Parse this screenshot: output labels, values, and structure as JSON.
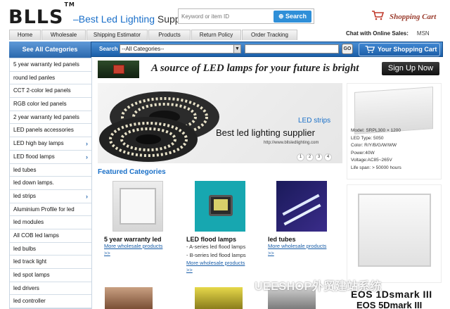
{
  "header": {
    "logo": "BLLS",
    "trademark": "TM",
    "tagline_prefix": "–Best ",
    "tagline_highlight": "Led Lighting",
    "tagline_suffix": " Supplier",
    "search_placeholder": "Keyword or item ID",
    "search_button": "Search",
    "cart_link": "Shopping Cart"
  },
  "nav": {
    "tabs": [
      {
        "label": "Home"
      },
      {
        "label": "Wholesale"
      },
      {
        "label": "Shipping Estimator"
      },
      {
        "label": "Products"
      },
      {
        "label": "Return Policy"
      },
      {
        "label": "Order Tracking"
      }
    ],
    "chat_label": "Chat with Online Sales:",
    "msn": "MSN"
  },
  "searchbar": {
    "see_all": "See All Categories",
    "label": "Search",
    "category_selected": "--All Categories--",
    "go": "GO",
    "cart_button": "Your Shopping Cart"
  },
  "sidebar": {
    "items": [
      {
        "label": "5 year warranty led panels",
        "chev": ""
      },
      {
        "label": "round led panles",
        "chev": ""
      },
      {
        "label": "CCT 2-color led panels",
        "chev": ""
      },
      {
        "label": "RGB color led panels",
        "chev": ""
      },
      {
        "label": "2 year warranty led panels",
        "chev": ""
      },
      {
        "label": "LED panels accessories",
        "chev": ""
      },
      {
        "label": "LED high bay lamps",
        "chev": "›"
      },
      {
        "label": "LED flood lamps",
        "chev": "›"
      },
      {
        "label": "led tubes",
        "chev": ""
      },
      {
        "label": "led down lamps.",
        "chev": ""
      },
      {
        "label": "led strips",
        "chev": "›"
      },
      {
        "label": "Aluminium Profile for led",
        "chev": ""
      },
      {
        "label": "led modules",
        "chev": ""
      },
      {
        "label": "All COB led lamps",
        "chev": ""
      },
      {
        "label": "led bulbs",
        "chev": ""
      },
      {
        "label": "led track light",
        "chev": ""
      },
      {
        "label": "led spot lamps",
        "chev": ""
      },
      {
        "label": "led drivers",
        "chev": ""
      },
      {
        "label": "led controller",
        "chev": ""
      }
    ]
  },
  "banner": {
    "slogan": "A source of LED lamps for your future is bright",
    "signup": "Sign Up Now"
  },
  "hero": {
    "category": "LED strips",
    "headline": "Best led lighting supplier",
    "url": "http://www.bllsledlighting.com",
    "pages": [
      "1",
      "2",
      "3",
      "4"
    ]
  },
  "side_product": {
    "specs": [
      "Model: SRPL300 × 1200",
      "LED Type: 5050",
      "Color: R/Y/B/G/W/WW",
      "Power:40W",
      "Voltage:AC85~265V",
      "Life span: > 50000 hours"
    ]
  },
  "featured": {
    "title": "Featured Categories",
    "products": [
      {
        "name": "5 year warranty led",
        "subs": [],
        "more": "More wholesale products",
        "more2": ">>"
      },
      {
        "name": "LED flood lamps",
        "subs": [
          "- A-series led flood lamps",
          "- B-series led flood lamps"
        ],
        "more": "More wholesale products",
        "more2": ">>"
      },
      {
        "name": "led tubes",
        "subs": [],
        "more": "More wholesale products",
        "more2": ">>"
      }
    ]
  },
  "brands": {
    "line1": "EOS 1Dsmark III",
    "line2": "EOS 5Dmark III"
  },
  "watermark": "UEESHOP外贸建站系统",
  "colors": {
    "accent_blue": "#1a70c8",
    "nav_blue": "#1a5ea8",
    "cart_red": "#9a3b2c"
  }
}
